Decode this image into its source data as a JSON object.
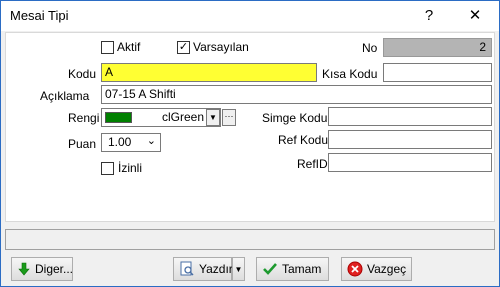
{
  "window": {
    "title": "Mesai Tipi",
    "help_glyph": "?",
    "close_glyph": "✕"
  },
  "form": {
    "aktif_label": "Aktif",
    "aktif_checked": false,
    "varsayilan_label": "Varsayılan",
    "varsayilan_checked": true,
    "no_label": "No",
    "no_value": "2",
    "kodu_label": "Kodu",
    "kodu_value": "A",
    "kisa_kodu_label": "Kısa Kodu",
    "kisa_kodu_value": "",
    "aciklama_label": "Açıklama",
    "aciklama_value": "07-15 A Shifti",
    "rengi_label": "Rengi",
    "rengi_value": "clGreen",
    "rengi_swatch": "#008000",
    "simge_kodu_label": "Simge Kodu",
    "simge_kodu_value": "",
    "puan_label": "Puan",
    "puan_value": "1.00",
    "ref_kodu_label": "Ref Kodu",
    "ref_kodu_value": "",
    "izinli_label": "İzinli",
    "izinli_checked": false,
    "refid_label": "RefID",
    "refid_value": ""
  },
  "buttons": {
    "diger": "Diger...",
    "yazdir": "Yazdır",
    "tamam": "Tamam",
    "vazgec": "Vazgeç"
  },
  "colors": {
    "kodu_bg": "#ffff33",
    "no_bg": "#b4b4b4",
    "accent_border": "#2b6cc4"
  }
}
